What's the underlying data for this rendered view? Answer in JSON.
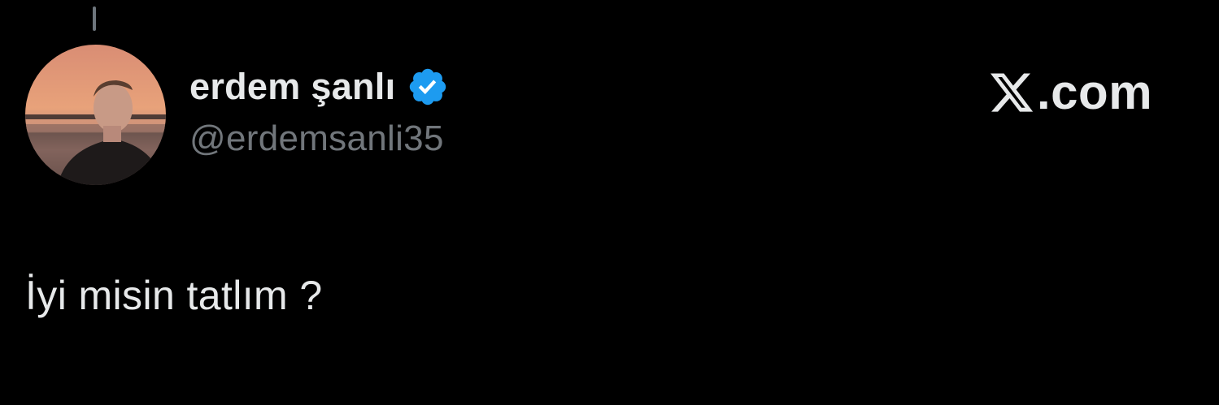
{
  "tweet": {
    "author": {
      "display_name": "erdem şanlı",
      "handle": "@erdemsanli35",
      "verified": true,
      "verified_icon": "verified-badge-icon",
      "avatar_icon": "profile-photo-sunset"
    },
    "text": "İyi misin tatlım ?"
  },
  "brand": {
    "logo_icon": "x-logo-icon",
    "text": ".com"
  },
  "colors": {
    "background": "#000000",
    "primary_text": "#e7e9ea",
    "secondary_text": "#71767b",
    "verified_blue": "#1d9bf0"
  }
}
